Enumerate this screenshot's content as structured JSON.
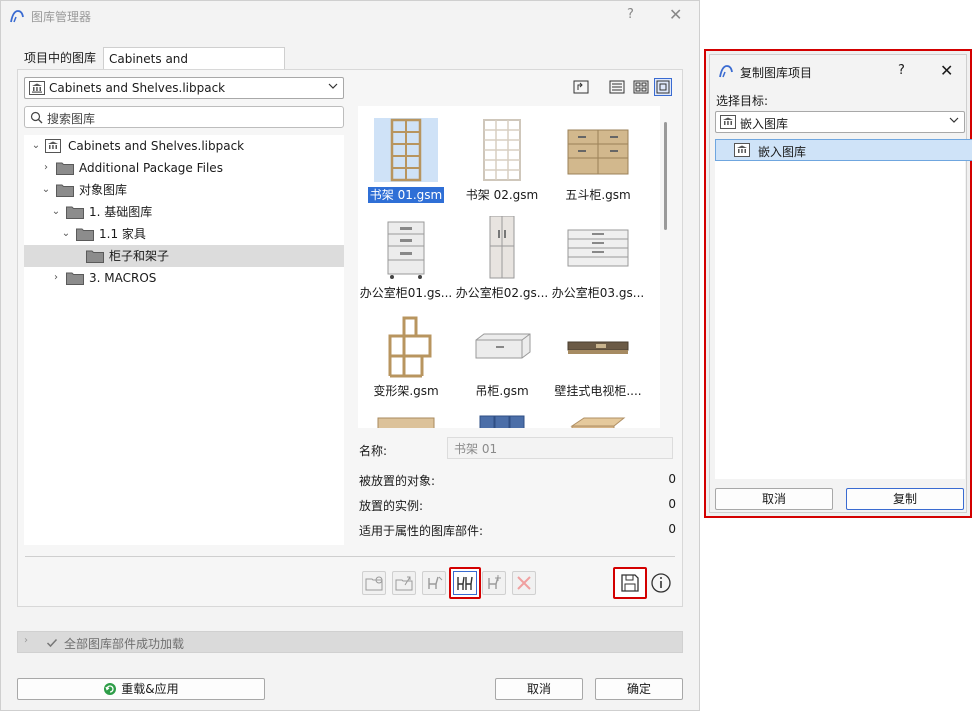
{
  "main_dialog": {
    "title": "图库管理器",
    "help": "?",
    "close": "✕",
    "tabs": [
      "项目中的图库",
      "Cabinets and Shelves.libpack"
    ],
    "library_dropdown": "Cabinets and Shelves.libpack",
    "search_placeholder": "搜索图库",
    "tree": [
      {
        "label": "Cabinets and Shelves.libpack",
        "expanded": true,
        "icon": "library-icon"
      },
      {
        "label": "Additional Package Files",
        "expanded": false,
        "icon": "folder-icon"
      },
      {
        "label": "对象图库",
        "expanded": true,
        "icon": "folder-icon"
      },
      {
        "label": "1. 基础图库",
        "expanded": true,
        "icon": "folder-icon"
      },
      {
        "label": "1.1 家具",
        "expanded": true,
        "icon": "folder-icon"
      },
      {
        "label": "柜子和架子",
        "expanded": false,
        "icon": "folder-icon",
        "selected": true
      },
      {
        "label": "3. MACROS",
        "expanded": false,
        "icon": "folder-icon"
      }
    ],
    "items": [
      {
        "name": "书架 01.gsm",
        "selected": true
      },
      {
        "name": "书架 02.gsm"
      },
      {
        "name": "五斗柜.gsm"
      },
      {
        "name": "办公室柜01.gs..."
      },
      {
        "name": "办公室柜02.gs..."
      },
      {
        "name": "办公室柜03.gs..."
      },
      {
        "name": "变形架.gsm"
      },
      {
        "name": "吊柜.gsm"
      },
      {
        "name": "壁挂式电视柜...."
      }
    ],
    "info": {
      "name_label": "名称:",
      "name_value": "书架 01",
      "placed_objects_label": "被放置的对象:",
      "placed_objects_value": "0",
      "placed_instances_label": "放置的实例:",
      "placed_instances_value": "0",
      "attribute_parts_label": "适用于属性的图库部件:",
      "attribute_parts_value": "0"
    },
    "status": "全部图库部件成功加载",
    "reload_button": "重载&应用",
    "cancel_button": "取消",
    "ok_button": "确定"
  },
  "copy_dialog": {
    "title": "复制图库项目",
    "help": "?",
    "close": "✕",
    "target_label": "选择目标:",
    "target_dropdown": "嵌入图库",
    "list": [
      {
        "label": "嵌入图库",
        "selected": true
      }
    ],
    "cancel_button": "取消",
    "copy_button": "复制"
  },
  "colors": {
    "highlight": "#d30000",
    "selection": "#2f6fd6",
    "accent": "#3a6bd1"
  }
}
